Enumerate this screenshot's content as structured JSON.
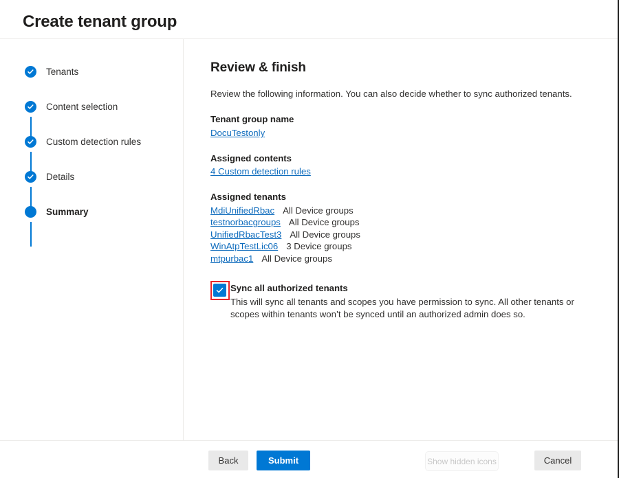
{
  "header": {
    "title": "Create tenant group"
  },
  "stepper": {
    "steps": [
      {
        "label": "Tenants",
        "state": "completed",
        "icon": "check-icon"
      },
      {
        "label": "Content selection",
        "state": "completed",
        "icon": "check-icon"
      },
      {
        "label": "Custom detection rules",
        "state": "completed",
        "icon": "check-icon"
      },
      {
        "label": "Details",
        "state": "completed",
        "icon": "check-icon"
      },
      {
        "label": "Summary",
        "state": "active",
        "icon": "dot-icon"
      }
    ]
  },
  "main": {
    "section_title": "Review & finish",
    "section_description": "Review the following information. You can also decide whether to sync authorized tenants.",
    "tenant_group_name": {
      "label": "Tenant group name",
      "value": "DocuTestonly"
    },
    "assigned_contents": {
      "label": "Assigned contents",
      "value": "4 Custom detection rules"
    },
    "assigned_tenants": {
      "label": "Assigned tenants",
      "rows": [
        {
          "name": "MdiUnifiedRbac",
          "scope": "All Device groups"
        },
        {
          "name": "testnorbacgroups",
          "scope": "All Device groups"
        },
        {
          "name": "UnifiedRbacTest3",
          "scope": "All Device groups"
        },
        {
          "name": "WinAtpTestLic06",
          "scope": "3 Device groups"
        },
        {
          "name": "mtpurbac1",
          "scope": "All Device groups"
        }
      ]
    },
    "sync": {
      "checked": true,
      "label": "Sync all authorized tenants",
      "description": "This will sync all tenants and scopes you have permission to sync. All other tenants or scopes within tenants won’t be synced until an authorized admin does so."
    }
  },
  "footer": {
    "back_label": "Back",
    "submit_label": "Submit",
    "cancel_label": "Cancel"
  },
  "overlay": {
    "show_hidden_icons_label": "Show hidden icons"
  },
  "colors": {
    "accent": "#0078d4",
    "link": "#0f6cbd",
    "text": "#323130",
    "heading": "#201f1e",
    "divider": "#edebe9",
    "highlight": "#e8252a",
    "secondary_button": "#e9e9e9"
  }
}
